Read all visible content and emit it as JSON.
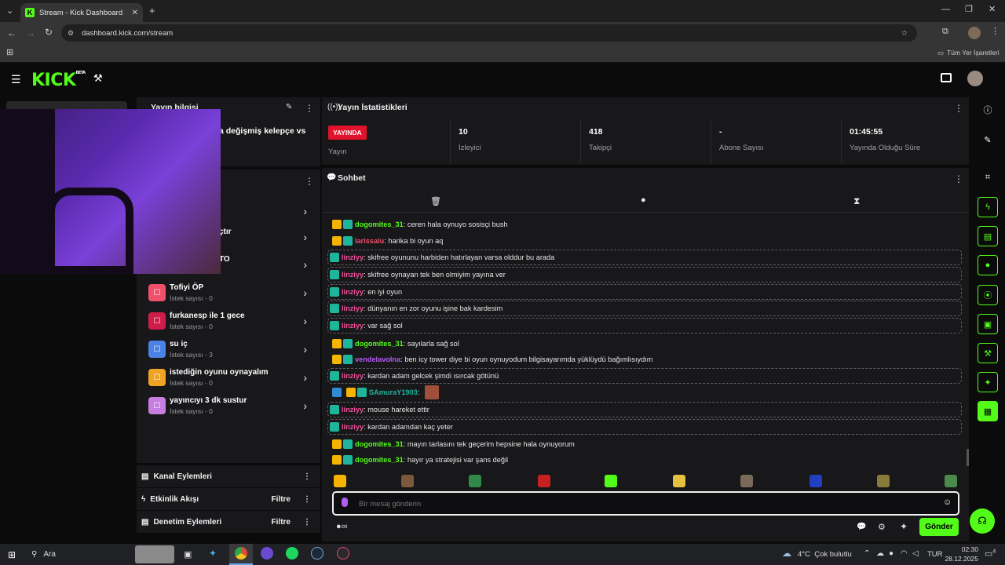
{
  "browser": {
    "tab_title": "Stream - Kick Dashboard",
    "url": "dashboard.kick.com/stream",
    "bookmarks_label": "Tüm Yer İşaretleri"
  },
  "header": {
    "logo": "KICK",
    "logo_sup": "BETA"
  },
  "stream_info": {
    "title": "Yayın bilgisi",
    "stream_title_fragment": "a değişmiş kelepçe vs"
  },
  "stats": {
    "title": "Yayın İstatistikleri",
    "items": [
      {
        "value": "YAYINDA",
        "label": "Yayın"
      },
      {
        "value": "10",
        "label": "İzleyici"
      },
      {
        "value": "418",
        "label": "Takipçi"
      },
      {
        "value": "-",
        "label": "Abone Sayısı"
      },
      {
        "value": "01:45:55",
        "label": "Yayında Olduğu Süre"
      }
    ]
  },
  "rewards": {
    "partial": [
      "çtır",
      "TO"
    ],
    "items": [
      {
        "title": "Tofiyi ÖP",
        "sub": "İstek sayısı - 0",
        "color": "#f0506a"
      },
      {
        "title": "furkanesp ile 1 gece",
        "sub": "İstek sayısı - 0",
        "color": "#d01c4a"
      },
      {
        "title": "su iç",
        "sub": "İstek sayısı - 3",
        "color": "#4a82e6"
      },
      {
        "title": "istediğin oyunu oynayalım",
        "sub": "İstek sayısı - 0",
        "color": "#f0a224"
      },
      {
        "title": "yayıncıyı 3 dk sustur",
        "sub": "İstek sayısı - 0",
        "color": "#c67ee0"
      }
    ]
  },
  "sections": {
    "channel_actions": "Kanal Eylemleri",
    "activity_feed": "Etkinlik Akışı",
    "mod_actions": "Denetim Eylemleri",
    "filter": "Filtre"
  },
  "chat": {
    "title": "Sohbet",
    "placeholder": "Bir mesaj gönderin",
    "send": "Gönder",
    "messages": [
      {
        "user": "dogomites_31",
        "color": "#53fc18",
        "badges": [
          "crown",
          "green"
        ],
        "text": "ceren hala oynuyo sosisçi bush",
        "hl": false
      },
      {
        "user": "larissalu",
        "color": "#f0506a",
        "badges": [
          "crown",
          "green"
        ],
        "text": "harika bi oyun aq",
        "hl": false
      },
      {
        "user": "linziyy",
        "color": "#f0509a",
        "badges": [
          "green"
        ],
        "text": "skifree oyununu harbiden hatırlayan varsa olddur bu arada",
        "hl": true
      },
      {
        "user": "linziyy",
        "color": "#f0509a",
        "badges": [
          "green"
        ],
        "text": "skifree oynayan tek ben olmiyim yayına ver",
        "hl": true
      },
      {
        "user": "linziyy",
        "color": "#f0509a",
        "badges": [
          "green"
        ],
        "text": "en iyi oyun",
        "hl": true
      },
      {
        "user": "linziyy",
        "color": "#f0509a",
        "badges": [
          "green"
        ],
        "text": "dünyanın en zor oyunu işine bak kardesim",
        "hl": true
      },
      {
        "user": "linziyy",
        "color": "#f0509a",
        "badges": [
          "green"
        ],
        "text": "var sağ sol",
        "hl": true
      },
      {
        "user": "dogomites_31",
        "color": "#53fc18",
        "badges": [
          "crown",
          "green"
        ],
        "text": "sayılarla sağ sol",
        "hl": false
      },
      {
        "user": "vendelavolna",
        "color": "#b35cf2",
        "badges": [
          "crown",
          "green"
        ],
        "text": "ben icy tower diye bi oyun oynuyodum bilgisayarımda yüklüydü bağımlısıydım",
        "hl": false
      },
      {
        "user": "linziyy",
        "color": "#f0509a",
        "badges": [
          "green"
        ],
        "text": "kardan adam gelcek şimdi ısırcak götünü",
        "hl": true
      },
      {
        "user": "SAmuraY1903",
        "color": "#1fb59b",
        "badges": [
          "blue",
          "crown",
          "green"
        ],
        "text": "",
        "hl": false
      },
      {
        "user": "linziyy",
        "color": "#f0509a",
        "badges": [
          "green"
        ],
        "text": "mouse hareket ettir",
        "hl": true
      },
      {
        "user": "linziyy",
        "color": "#f0509a",
        "badges": [
          "green"
        ],
        "text": "kardan adamdan kaç yeter",
        "hl": true
      },
      {
        "user": "dogomites_31",
        "color": "#53fc18",
        "badges": [
          "crown",
          "green"
        ],
        "text": "mayın tarlasını tek geçerim hepsine hala oynuyorum",
        "hl": false
      },
      {
        "user": "dogomites_31",
        "color": "#53fc18",
        "badges": [
          "crown",
          "green"
        ],
        "text": "hayır ya stratejisi var şans değil",
        "hl": false
      }
    ]
  },
  "taskbar": {
    "search": "Ara",
    "weather": "4°C  Çok bulutlu",
    "lang": "TUR",
    "time": "02:30",
    "date": "28.12.2025",
    "notif": "4"
  }
}
